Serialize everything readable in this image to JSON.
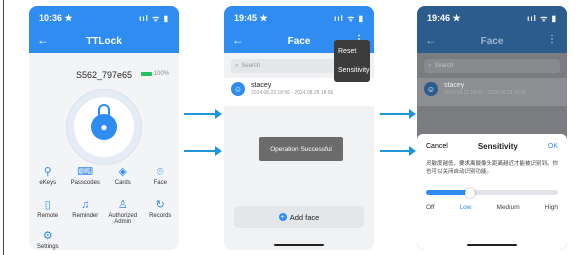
{
  "phone1": {
    "time": "10:36 ★",
    "status_icons": "ııl ᯤ ▮",
    "title": "TTLock",
    "lock_name": "S562_797e65",
    "battery": "100%",
    "features": [
      {
        "label": "eKeys",
        "icon": "ekey-icon",
        "glyph": "⚲"
      },
      {
        "label": "Passcodes",
        "icon": "passcode-icon",
        "glyph": "⌨"
      },
      {
        "label": "Cards",
        "icon": "card-icon",
        "glyph": "◈"
      },
      {
        "label": "Face",
        "icon": "face-icon",
        "glyph": "⌾"
      },
      {
        "label": "Remote",
        "icon": "remote-icon",
        "glyph": "▯"
      },
      {
        "label": "Reminder",
        "icon": "bell-icon",
        "glyph": "♫"
      },
      {
        "label": "Authorized Admin",
        "icon": "admin-icon",
        "glyph": "♙"
      },
      {
        "label": "Records",
        "icon": "records-icon",
        "glyph": "↻"
      },
      {
        "label": "Settings",
        "icon": "gear-icon",
        "glyph": "⚙"
      }
    ]
  },
  "phone2": {
    "time": "19:45 ★",
    "title": "Face",
    "search_placeholder": "Search",
    "face_name": "stacey",
    "face_period": "2024.08.22 18:56 - 2024.08.25 18:56",
    "menu": [
      "Reset",
      "Sensitivity"
    ],
    "toast": "Operation Successful",
    "add_button": "Add face"
  },
  "phone3": {
    "time": "19:46 ★",
    "title": "Face",
    "sheet": {
      "cancel": "Cancel",
      "title": "Sensitivity",
      "ok": "OK",
      "description": "灵敏度越低，要求离摄像头距离越近才能被识别到。你也可以关闭自动识别功能。",
      "levels": [
        "Off",
        "Low",
        "Medium",
        "High"
      ],
      "selected_level": "Low",
      "slider_fraction": 0.33
    }
  },
  "colors": {
    "accent": "#2f8cf0",
    "arrow": "#2096d8"
  }
}
